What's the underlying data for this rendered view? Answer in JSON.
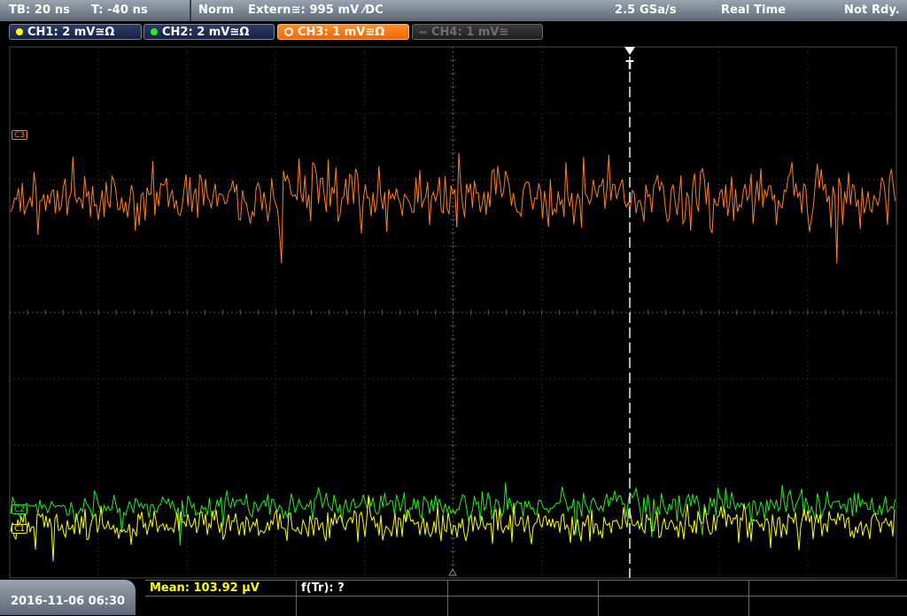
{
  "status": {
    "timebase": "TB: 20 ns",
    "trigger_offset": "T: -40 ns",
    "trigger_mode": "Norm",
    "trigger_source": "Extern≅: 995 mV ⁄DC",
    "sample_rate": "2.5 GSa/s",
    "acq_mode": "Real Time",
    "run_state": "Not Rdy."
  },
  "channels": [
    {
      "label": "CH1: 2 mV≅Ω",
      "color": "#ffff00",
      "state": "on"
    },
    {
      "label": "CH2: 2 mV≅Ω",
      "color": "#22ee22",
      "state": "on"
    },
    {
      "label": "CH3: 1 mV≅Ω",
      "color": "#ff7f1e",
      "state": "active"
    },
    {
      "label": "CH4: 1 mV≅",
      "color": "#777777",
      "state": "off"
    }
  ],
  "markers": {
    "c3": "C3",
    "c2": "C2",
    "c1": "C1",
    "trigger": "T"
  },
  "datetime": "2016-11-06 06:30",
  "measurements": {
    "mean": "Mean: 103.92 µV",
    "freq": "f(Tr): ?"
  },
  "colors": {
    "ch1": "#ffff00",
    "ch2": "#22ee22",
    "ch3": "#ff7f1e",
    "grid": "#4a4a4a",
    "trigger": "#ffffff"
  }
}
